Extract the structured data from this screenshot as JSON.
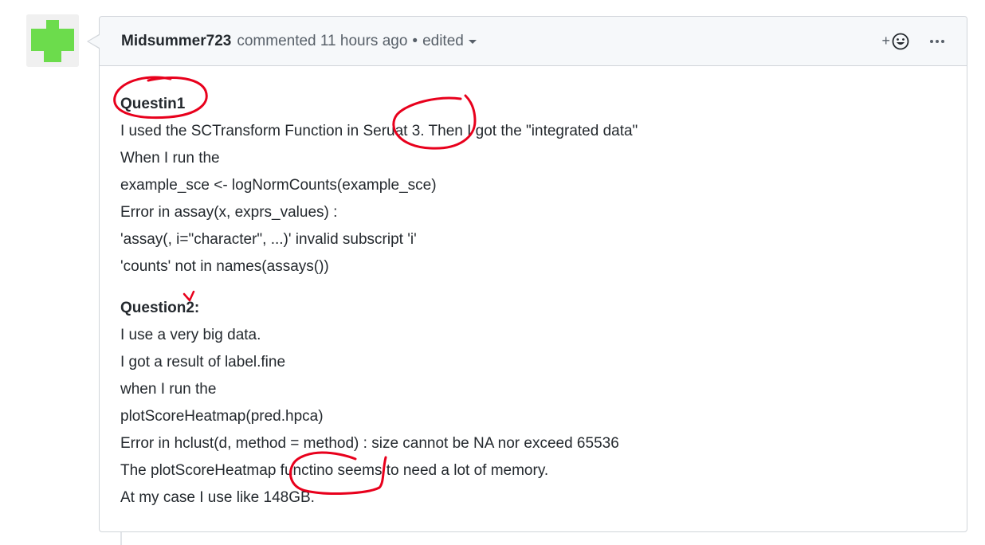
{
  "comment": {
    "author": "Midsummer723",
    "action_text": "commented 11 hours ago",
    "bullet": "•",
    "edited_label": "edited",
    "reaction_plus": "+",
    "body": {
      "question1": {
        "heading": "Questin1",
        "lines": [
          "I used the SCTransform Function in Seruat 3. Then I got the \"integrated data\"",
          "When I run the",
          "example_sce <- logNormCounts(example_sce)",
          "Error in assay(x, exprs_values) :",
          "'assay(, i=\"character\", ...)' invalid subscript 'i'",
          "'counts' not in names(assays())"
        ]
      },
      "question2": {
        "heading": "Question2:",
        "lines": [
          "I use a very big data.",
          "I got a result of label.fine",
          "when I run the",
          "plotScoreHeatmap(pred.hpca)",
          "Error in hclust(d, method = method) : size cannot be NA nor exceed 65536",
          "The plotScoreHeatmap functino seems to need a lot of memory.",
          "At my case I use like 148GB."
        ]
      }
    }
  },
  "icons": {
    "avatar": "identicon-avatar",
    "reaction": "smiley-icon",
    "more": "kebab-horizontal-icon",
    "caret": "caret-down-icon"
  },
  "colors": {
    "annotation_red": "#e8001c",
    "identicon_green": "#6cdc4c",
    "header_bg": "#f6f8fa",
    "border": "#d1d5da"
  }
}
